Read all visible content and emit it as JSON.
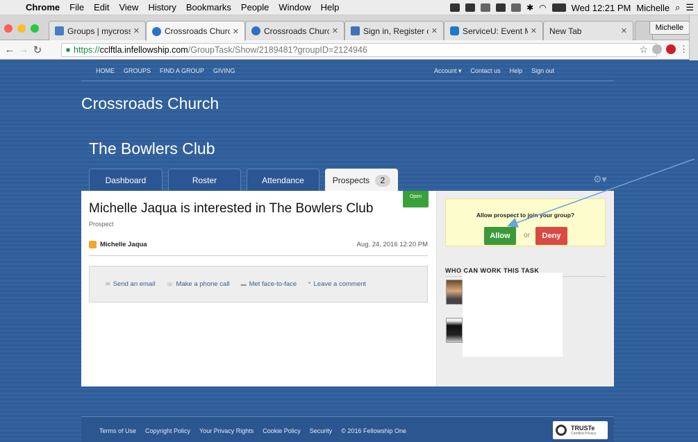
{
  "menubar": {
    "app": "Chrome",
    "items": [
      "File",
      "Edit",
      "View",
      "History",
      "Bookmarks",
      "People",
      "Window",
      "Help"
    ],
    "clock": "Wed 12:21 PM",
    "user": "Michelle"
  },
  "tabs": [
    {
      "label": "Groups | mycrossroa",
      "color": "#4a7cc2"
    },
    {
      "label": "Crossroads Church - |",
      "color": "#2c73c6"
    },
    {
      "label": "Crossroads Church -",
      "color": "#2c73c6"
    },
    {
      "label": "Sign in, Register or G",
      "color": "#3f73b8"
    },
    {
      "label": "ServiceU: Event Mana",
      "color": "#1f79c8"
    },
    {
      "label": "New Tab",
      "color": ""
    }
  ],
  "profile_button": "Michelle",
  "address": {
    "https": "https://",
    "host": "cclftla.infellowship.com",
    "path": "/GroupTask/Show/2189481?groupID=2124946"
  },
  "nav": {
    "left": [
      "HOME",
      "GROUPS",
      "FIND A GROUP",
      "GIVING"
    ],
    "account": "Account ▾",
    "right": [
      "Contact us",
      "Help",
      "Sign out"
    ]
  },
  "church_name": "Crossroads Church",
  "group_name": "The Bowlers Club",
  "page_tabs": {
    "dashboard": "Dashboard",
    "roster": "Roster",
    "attendance": "Attendance",
    "prospects": "Prospects",
    "prospects_count": "2"
  },
  "task": {
    "status": "Open",
    "title": "Michelle Jaqua is interested in The Bowlers Club",
    "subtitle": "Prospect",
    "person": "Michelle Jaqua",
    "date": "Aug. 24, 2016 12:20 PM"
  },
  "actions": {
    "email": "Send an email",
    "phone": "Make a phone call",
    "meet": "Met face-to-face",
    "comment": "Leave a comment"
  },
  "allow": {
    "question": "Allow prospect to join your group?",
    "allow_label": "Allow",
    "or": "or",
    "deny_label": "Deny"
  },
  "who_heading": "WHO CAN WORK THIS TASK",
  "footer": {
    "links": [
      "Terms of Use",
      "Copyright Policy",
      "Your Privacy Rights",
      "Cookie Policy",
      "Security",
      "© 2016 Fellowship One"
    ],
    "truste": "TRUSTe",
    "truste_sub": "Certified Privacy"
  },
  "colors": {
    "page_background": "#2f5e98",
    "allow": "#3a9a3a",
    "deny": "#d94a42",
    "open_badge": "#3aa13a",
    "annotation_arrow": "#6aa3d8"
  }
}
